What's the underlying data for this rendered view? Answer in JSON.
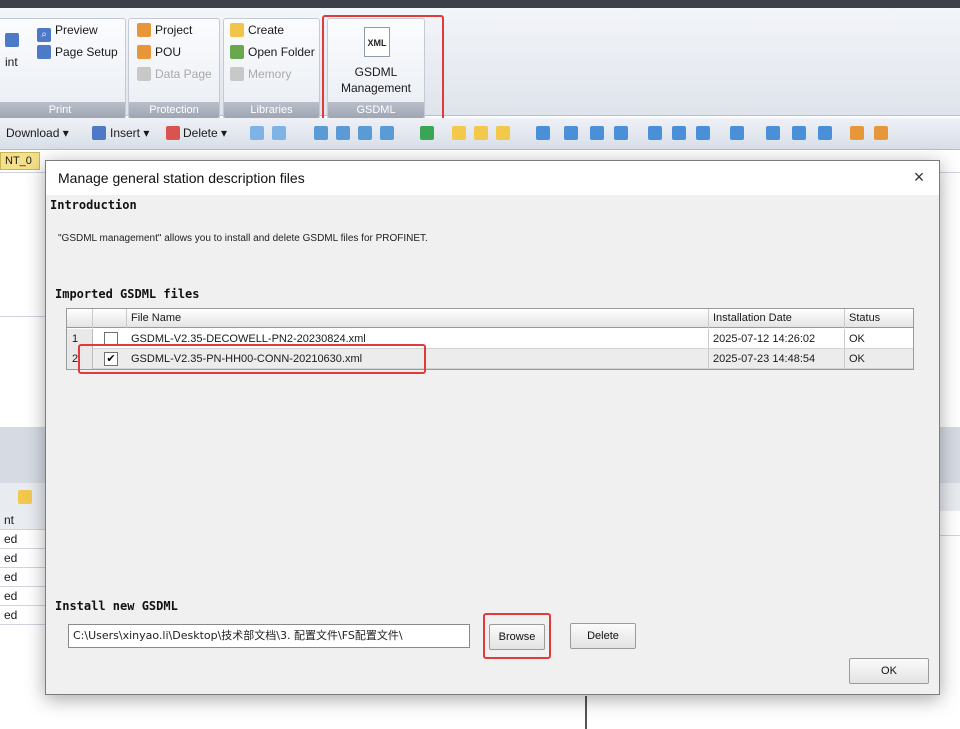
{
  "ribbon": {
    "print_group": {
      "label": "Print",
      "cut_text": "int",
      "preview": "Preview",
      "page_setup": "Page Setup"
    },
    "protection_group": {
      "label": "Protection",
      "project": "Project",
      "pou": "POU",
      "data_page": "Data Page"
    },
    "libraries_group": {
      "label": "Libraries",
      "create": "Create",
      "open_folder": "Open Folder",
      "memory": "Memory"
    },
    "gsdml_group": {
      "label": "GSDML",
      "icon_text": "XML",
      "button_line1": "GSDML",
      "button_line2": "Management"
    }
  },
  "toolbar": {
    "download": "Download",
    "insert": "Insert",
    "delete": "Delete"
  },
  "background": {
    "tab_label": "NT_0",
    "rows": [
      "nt",
      "ed",
      "ed",
      "ed",
      "ed",
      "ed"
    ]
  },
  "dialog": {
    "title": "Manage general station description files",
    "close_glyph": "×",
    "introduction_heading": "Introduction",
    "introduction_text": "\"GSDML management\" allows you to install and delete GSDML files for PROFINET.",
    "imported_heading": "Imported GSDML files",
    "table": {
      "columns": [
        "File Name",
        "Installation Date",
        "Status"
      ],
      "rows": [
        {
          "num": "1",
          "checked": false,
          "file": "GSDML-V2.35-DECOWELL-PN2-20230824.xml",
          "date": "2025-07-12 14:26:02",
          "status": "OK"
        },
        {
          "num": "2",
          "checked": true,
          "file": "GSDML-V2.35-PN-HH00-CONN-20210630.xml",
          "date": "2025-07-23 14:48:54",
          "status": "OK"
        }
      ]
    },
    "install_heading": "Install new GSDML",
    "path_value": "C:\\Users\\xinyao.li\\Desktop\\技术部文档\\3. 配置文件\\FS配置文件\\",
    "browse_label": "Browse",
    "delete_label": "Delete",
    "ok_label": "OK"
  },
  "colors": {
    "highlight_red": "#e03a3a",
    "ribbon_group_label": "#9da4b1"
  }
}
